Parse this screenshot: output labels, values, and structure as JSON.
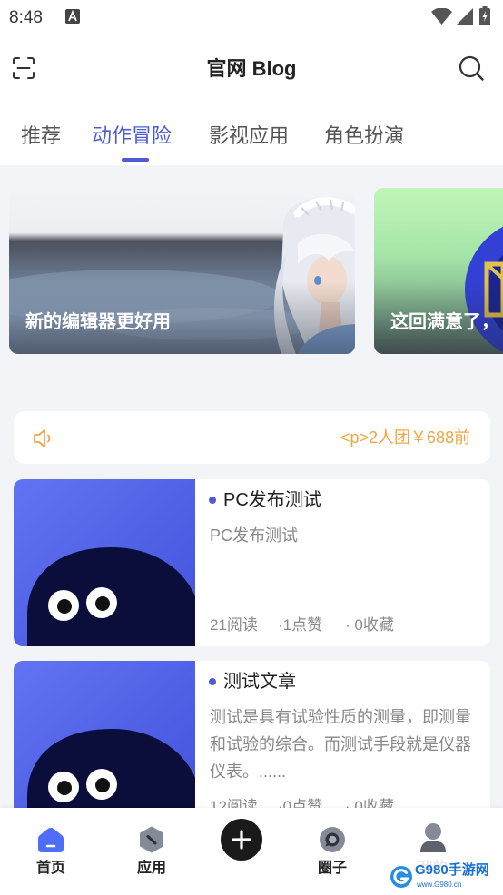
{
  "status_bar": {
    "time": "8:48",
    "icons": [
      "a-notification-icon",
      "wifi-icon",
      "signal-icon",
      "battery-icon"
    ]
  },
  "header": {
    "title": "官网 Blog",
    "left_icon": "scan-icon",
    "right_icon": "search-icon"
  },
  "tabs": [
    {
      "label": "推荐",
      "active": false
    },
    {
      "label": "动作冒险",
      "active": true
    },
    {
      "label": "影视应用",
      "active": false
    },
    {
      "label": "角色扮演",
      "active": false
    }
  ],
  "banners": [
    {
      "caption": "新的编辑器更好用"
    },
    {
      "caption": "这回满意了，"
    }
  ],
  "notice": {
    "icon": "speaker-icon",
    "text": "<p>2人团￥688前"
  },
  "articles": [
    {
      "title": "PC发布测试",
      "summary": "PC发布测试",
      "reads": "21阅读",
      "likes": "·1点赞",
      "favorites": "· 0收藏"
    },
    {
      "title": "测试文章",
      "summary": "测试是具有试验性质的测量，即测量和试验的综合。而测试手段就是仪器仪表。......",
      "reads": "12阅读",
      "likes": "·0点赞",
      "favorites": "· 0收藏"
    }
  ],
  "bottom_nav": {
    "items": [
      {
        "label": "首页",
        "icon": "home-icon",
        "active": true
      },
      {
        "label": "应用",
        "icon": "apps-icon",
        "active": false
      },
      {
        "icon": "plus-icon"
      },
      {
        "label": "圈子",
        "icon": "circle-icon",
        "active": false
      },
      {
        "label": "我的",
        "icon": "user-icon",
        "active": false
      }
    ]
  },
  "watermark": {
    "name": "G980手游网",
    "url": "www.G980.cn"
  },
  "colors": {
    "accent": "#4f5bd5",
    "notice": "#f2a541",
    "nav_active": "#4f6ef7",
    "background": "#f3f4f8"
  }
}
